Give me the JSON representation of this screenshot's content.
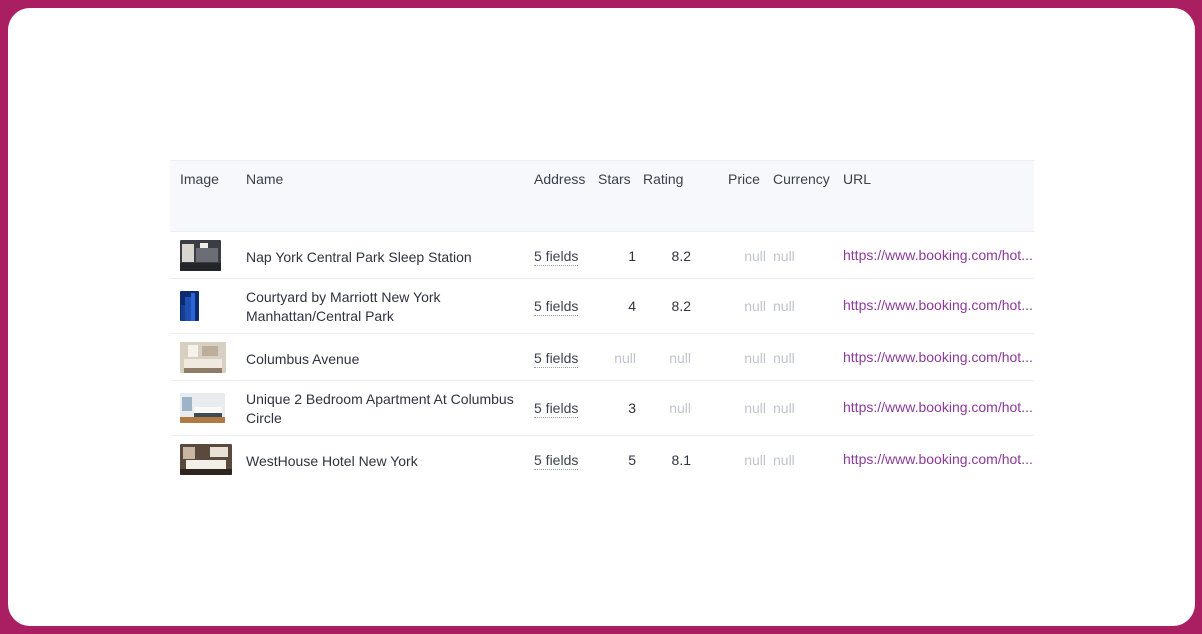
{
  "columns": {
    "image": "Image",
    "name": "Name",
    "address": "Address",
    "stars": "Stars",
    "rating": "Rating",
    "price": "Price",
    "currency": "Currency",
    "url": "URL"
  },
  "rows": [
    {
      "name": "Nap York Central Park Sleep Station",
      "address": "5 fields",
      "stars": "1",
      "rating": "8.2",
      "price": "null",
      "currency": "null",
      "url": "https://www.booking.com/hot..."
    },
    {
      "name": "Courtyard by Marriott New York Manhattan/Central Park",
      "address": "5 fields",
      "stars": "4",
      "rating": "8.2",
      "price": "null",
      "currency": "null",
      "url": "https://www.booking.com/hot..."
    },
    {
      "name": "Columbus Avenue",
      "address": "5 fields",
      "stars": "null",
      "rating": "null",
      "price": "null",
      "currency": "null",
      "url": "https://www.booking.com/hot..."
    },
    {
      "name": "Unique 2 Bedroom Apartment At Columbus Circle",
      "address": "5 fields",
      "stars": "3",
      "rating": "null",
      "price": "null",
      "currency": "null",
      "url": "https://www.booking.com/hot..."
    },
    {
      "name": "WestHouse Hotel New York",
      "address": "5 fields",
      "stars": "5",
      "rating": "8.1",
      "price": "null",
      "currency": "null",
      "url": "https://www.booking.com/hot..."
    }
  ],
  "colors": {
    "frame": "#a91f62",
    "link": "#8b3a9a",
    "null_text": "#bfc4d0"
  }
}
